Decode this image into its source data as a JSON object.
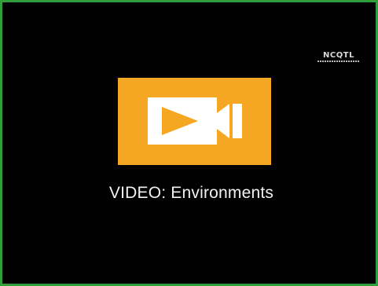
{
  "video": {
    "title": "VIDEO: Environments",
    "icon": "video-camera-icon",
    "card_color": "#f5a623"
  },
  "logo": {
    "text": "NCQTL",
    "tagline_visible_as_fine_print": true
  },
  "colors": {
    "background": "#000000",
    "border": "#2f9e3b",
    "title_text": "#f2f2f2"
  }
}
